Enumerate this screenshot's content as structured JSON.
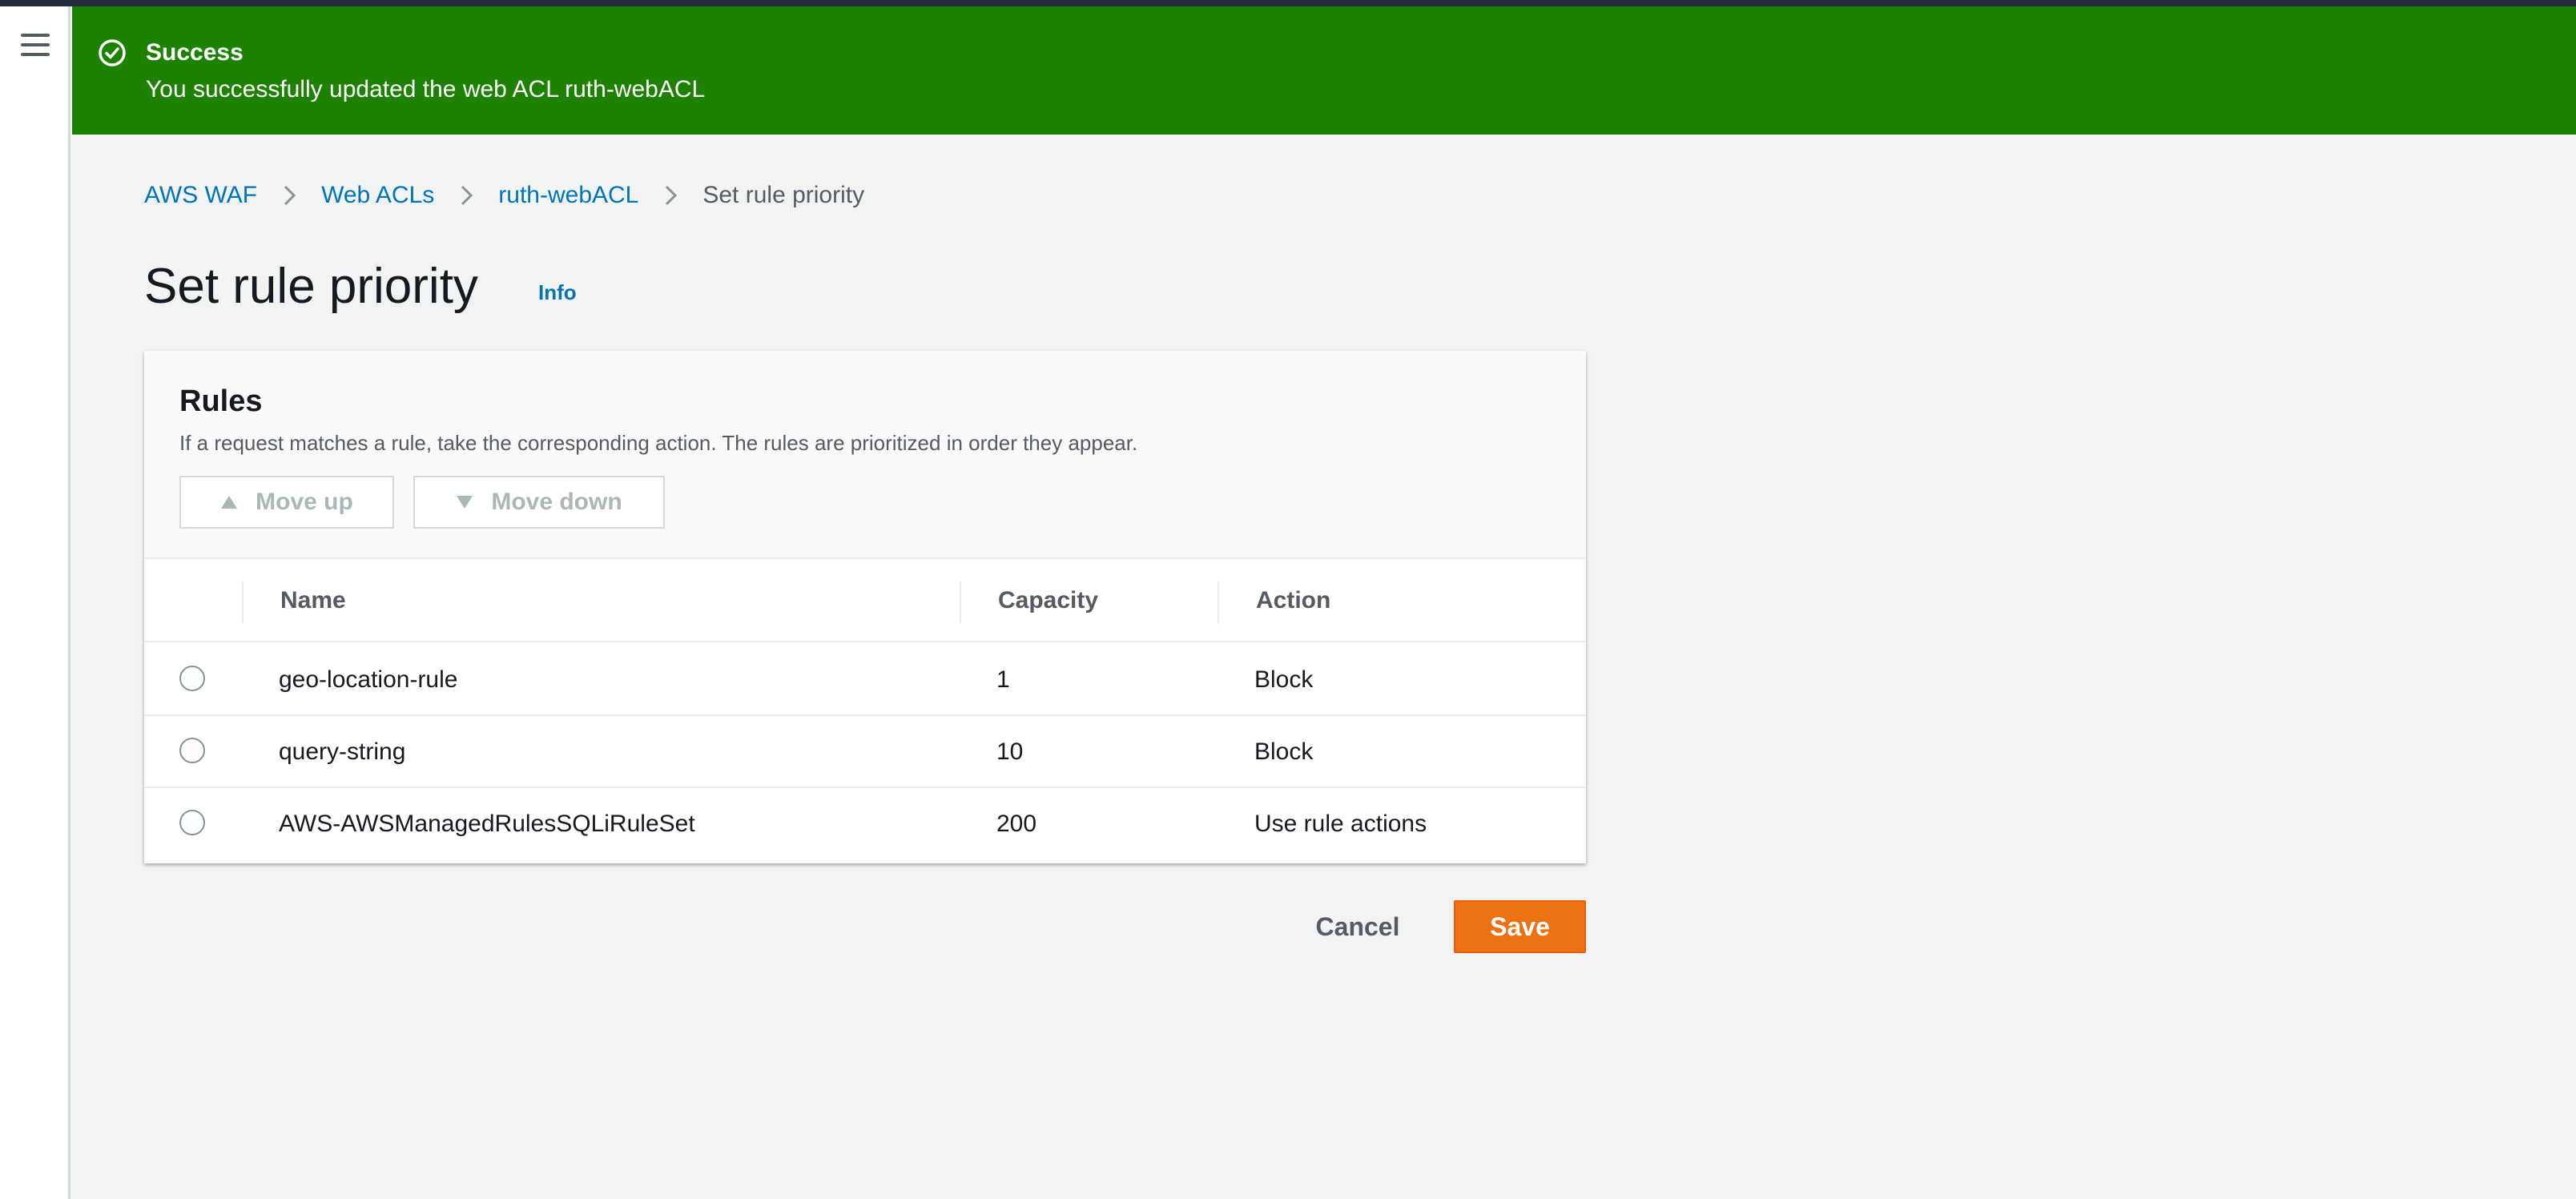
{
  "flash": {
    "title": "Success",
    "message": "You successfully updated the web ACL ruth-webACL",
    "color": "#1d8102"
  },
  "breadcrumb": {
    "items": [
      "AWS WAF",
      "Web ACLs",
      "ruth-webACL"
    ],
    "current": "Set rule priority"
  },
  "page": {
    "title": "Set rule priority",
    "info": "Info"
  },
  "rules": {
    "title": "Rules",
    "description": "If a request matches a rule, take the corresponding action. The rules are prioritized in order they appear.",
    "move_up": "Move up",
    "move_down": "Move down",
    "columns": [
      "Name",
      "Capacity",
      "Action"
    ],
    "rows": [
      {
        "name": "geo-location-rule",
        "capacity": "1",
        "action": "Block"
      },
      {
        "name": "query-string",
        "capacity": "10",
        "action": "Block"
      },
      {
        "name": "AWS-AWSManagedRulesSQLiRuleSet",
        "capacity": "200",
        "action": "Use rule actions"
      }
    ]
  },
  "actions": {
    "cancel": "Cancel",
    "save": "Save",
    "save_color": "#ec7211"
  }
}
